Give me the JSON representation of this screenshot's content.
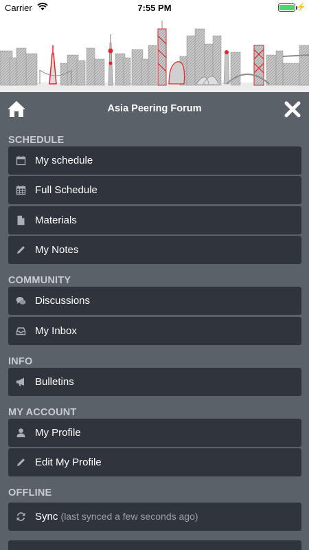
{
  "status_bar": {
    "carrier": "Carrier",
    "time": "7:55 PM"
  },
  "header": {
    "title": "Asia Peering Forum"
  },
  "sections": [
    {
      "label": "SCHEDULE",
      "items": [
        "My schedule",
        "Full Schedule",
        "Materials",
        "My Notes"
      ]
    },
    {
      "label": "COMMUNITY",
      "items": [
        "Discussions",
        "My Inbox"
      ]
    },
    {
      "label": "INFO",
      "items": [
        "Bulletins"
      ]
    },
    {
      "label": "MY ACCOUNT",
      "items": [
        "My Profile",
        "Edit My Profile"
      ]
    },
    {
      "label": "OFFLINE",
      "items": [
        "Sync"
      ],
      "sync_status": "(last synced a few seconds ago)"
    }
  ],
  "colors": {
    "background": "#5b6169",
    "item": "#30343c",
    "accent": "#e8232a"
  }
}
